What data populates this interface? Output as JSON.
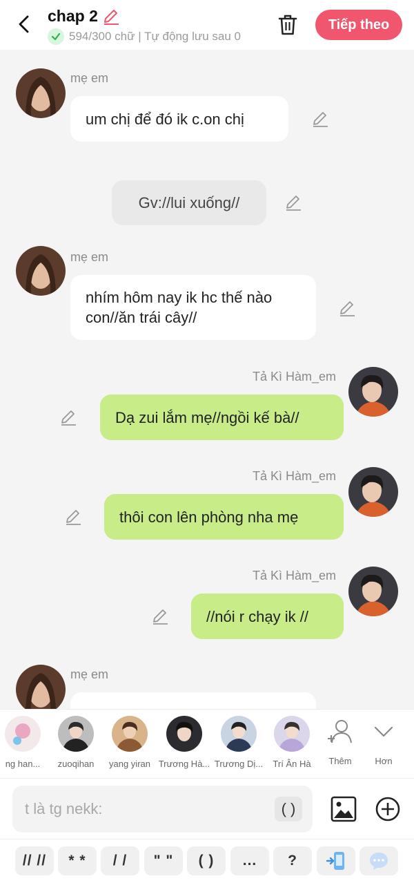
{
  "header": {
    "title": "chap 2",
    "status": "594/300 chữ | Tự động lưu sau 0",
    "next_label": "Tiếp theo",
    "accent_color": "#f0566d"
  },
  "messages": [
    {
      "type": "left",
      "sender": "mẹ em",
      "text": "um chị để đó ik c.on chị"
    },
    {
      "type": "narration",
      "text": "Gv://lui xuống//"
    },
    {
      "type": "left",
      "sender": "mẹ em",
      "text": "nhím hôm nay ik hc thế nào con//ăn trái cây//"
    },
    {
      "type": "right",
      "sender": "Tả Kì Hàm_em",
      "text": "Dạ zui lắm mẹ//ngồi kế bà//"
    },
    {
      "type": "right",
      "sender": "Tả Kì Hàm_em",
      "text": "thôi con lên phòng nha mẹ"
    },
    {
      "type": "right",
      "sender": "Tả Kì Hàm_em",
      "text": "//nói r chạy ik //"
    },
    {
      "type": "left",
      "sender": "mẹ em",
      "text": ""
    }
  ],
  "contacts": [
    {
      "name": "ng han..."
    },
    {
      "name": "zuoqihan"
    },
    {
      "name": "yang yiran"
    },
    {
      "name": "Trương Hà..."
    },
    {
      "name": "Trương Dị..."
    },
    {
      "name": "Trí Ân Hà"
    }
  ],
  "tools": {
    "add_label": "Thêm",
    "more_label": "Hơn"
  },
  "input": {
    "placeholder": "t là tg nekk:",
    "paren_label": "( )"
  },
  "symbols": [
    "// //",
    "* *",
    "/ /",
    "\" \"",
    "( )",
    "...",
    "?"
  ]
}
